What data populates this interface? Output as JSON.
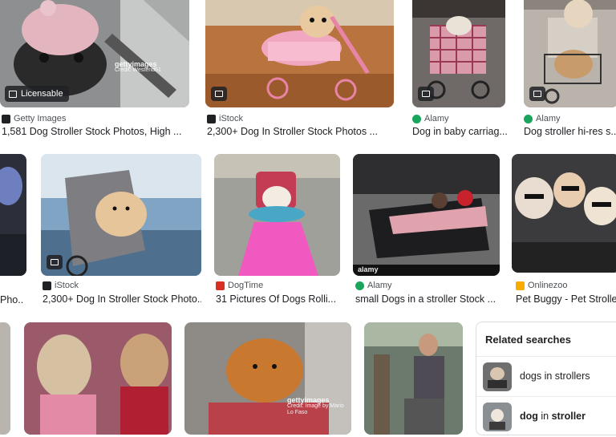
{
  "results": [
    {
      "source": "Getty Images",
      "caption": "1,581 Dog Stroller Stock Photos, High ...",
      "licensable": "Licensable",
      "watermark_brand": "gettyimages",
      "watermark_credit": "Credit: Westend61",
      "fav_color": "#202124"
    },
    {
      "source": "iStock",
      "caption": "2,300+ Dog In Stroller Stock Photos ...",
      "fav_color": "#202124"
    },
    {
      "source": "Alamy",
      "caption": "Dog in baby carriag...",
      "fav_color": "#19a55b"
    },
    {
      "source": "Alamy",
      "caption": "Dog stroller hi-res s...",
      "fav_color": "#19a55b"
    },
    {
      "source": "iStock",
      "caption": "2,300+ Dog In Stroller Stock Photo...",
      "fav_color": "#202124"
    },
    {
      "source": "DogTime",
      "caption": "31 Pictures Of Dogs Rolli...",
      "fav_color": "#d93025"
    },
    {
      "source": "Alamy",
      "caption": "small Dogs in a stroller Stock ...",
      "fav_color": "#19a55b",
      "watermark_brand": "alamy"
    },
    {
      "source": "Onlinezoo",
      "caption": "Pet Buggy - Pet Stroller",
      "fav_color": "#f9ab00"
    },
    {
      "source": "",
      "caption": "Pho..."
    },
    {
      "watermark_brand": "gettyimages",
      "watermark_credit": "Credit: Image by Mario Lo Faso"
    }
  ],
  "related": {
    "title": "Related searches",
    "items": [
      {
        "label": "dogs in strollers"
      },
      {
        "label_bold": "dog",
        "label_rest": " in ",
        "label_bold2": "stroller"
      }
    ]
  },
  "colors": {
    "accent": "#1a73e8",
    "text": "#202124",
    "muted": "#4d5156"
  }
}
